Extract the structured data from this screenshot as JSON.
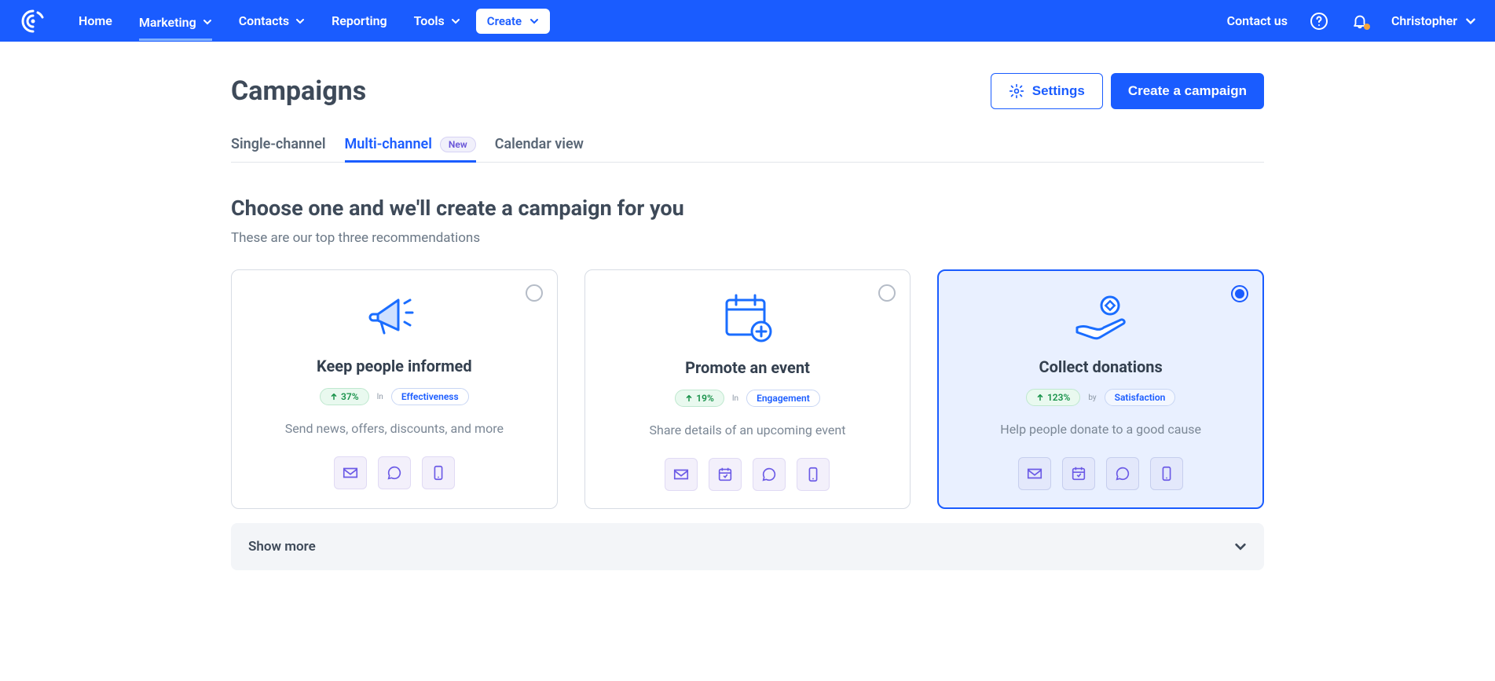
{
  "topnav": {
    "items": [
      "Home",
      "Marketing",
      "Contacts",
      "Reporting",
      "Tools"
    ],
    "withChevron": [
      false,
      true,
      true,
      false,
      true
    ],
    "activeIndex": 1,
    "createLabel": "Create",
    "contactUs": "Contact us",
    "userName": "Christopher"
  },
  "page": {
    "title": "Campaigns",
    "settingsLabel": "Settings",
    "createCampaignLabel": "Create a campaign"
  },
  "tabs": {
    "items": [
      "Single-channel",
      "Multi-channel",
      "Calendar view"
    ],
    "activeIndex": 1,
    "newBadgeIndex": 1,
    "newBadgeLabel": "New"
  },
  "section": {
    "title": "Choose one and we'll create a campaign for you",
    "subtitle": "These are our top three recommendations"
  },
  "cards": [
    {
      "title": "Keep people informed",
      "pct": "37%",
      "sep": "In",
      "metric": "Effectiveness",
      "desc": "Send news, offers, discounts, and more",
      "channels": [
        "email",
        "chat",
        "mobile"
      ],
      "selected": false,
      "icon": "megaphone"
    },
    {
      "title": "Promote an event",
      "pct": "19%",
      "sep": "In",
      "metric": "Engagement",
      "desc": "Share details of an upcoming event",
      "channels": [
        "email",
        "calendar",
        "chat",
        "mobile"
      ],
      "selected": false,
      "icon": "calendar-add"
    },
    {
      "title": "Collect donations",
      "pct": "123%",
      "sep": "by",
      "metric": "Satisfaction",
      "desc": "Help people donate to a good cause",
      "channels": [
        "email",
        "calendar",
        "chat",
        "mobile"
      ],
      "selected": true,
      "icon": "donate"
    }
  ],
  "showMore": "Show more"
}
